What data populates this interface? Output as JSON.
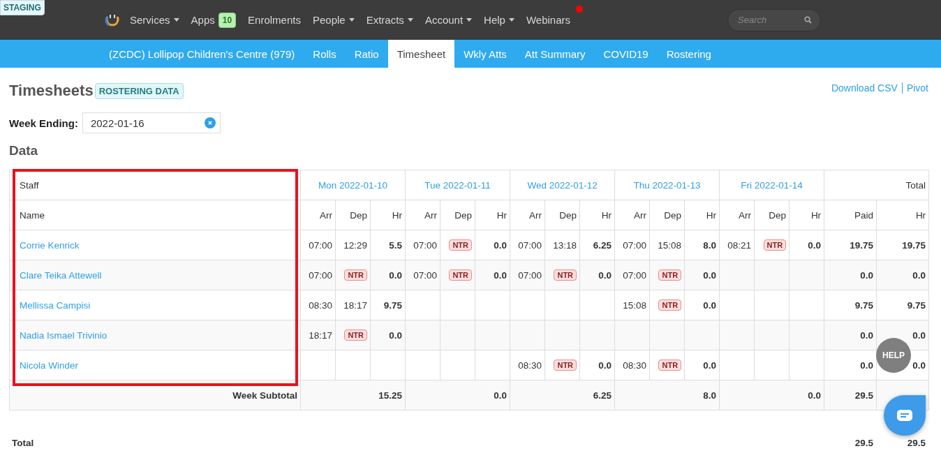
{
  "staging_badge": "STAGING",
  "nav": {
    "items": [
      {
        "label": "Services",
        "dropdown": true,
        "notification": false
      },
      {
        "label": "Apps",
        "badge": "10",
        "dropdown": false,
        "notification": false
      },
      {
        "label": "Enrolments",
        "dropdown": false,
        "notification": false
      },
      {
        "label": "People",
        "dropdown": true,
        "notification": false
      },
      {
        "label": "Extracts",
        "dropdown": true,
        "notification": false
      },
      {
        "label": "Account",
        "dropdown": true,
        "notification": false
      },
      {
        "label": "Help",
        "dropdown": true,
        "notification": false
      },
      {
        "label": "Webinars",
        "dropdown": false,
        "notification": true
      }
    ],
    "search": {
      "placeholder": "Search"
    }
  },
  "subnav": {
    "tabs": [
      {
        "label": "(ZCDC) Lollipop Children's Centre (979)",
        "selected": false
      },
      {
        "label": "Rolls",
        "selected": false
      },
      {
        "label": "Ratio",
        "selected": false
      },
      {
        "label": "Timesheet",
        "selected": true
      },
      {
        "label": "Wkly Atts",
        "selected": false
      },
      {
        "label": "Att Summary",
        "selected": false
      },
      {
        "label": "COVID19",
        "selected": false
      },
      {
        "label": "Rostering",
        "selected": false
      }
    ]
  },
  "page": {
    "title": "Timesheets",
    "tag": "ROSTERING DATA",
    "links": [
      "Download CSV",
      "Pivot"
    ],
    "week_ending": {
      "label": "Week Ending:",
      "value": "2022-01-16"
    },
    "section": "Data"
  },
  "table": {
    "group_header": "Staff",
    "name_header": "Name",
    "days": [
      {
        "label": "Mon 2022-01-10",
        "sub_headers": [
          "Arr",
          "Dep",
          "Hr"
        ],
        "subtotal": "15.25"
      },
      {
        "label": "Tue 2022-01-11",
        "sub_headers": [
          "Arr",
          "Dep",
          "Hr"
        ],
        "subtotal": "0.0"
      },
      {
        "label": "Wed 2022-01-12",
        "sub_headers": [
          "Arr",
          "Dep",
          "Hr"
        ],
        "subtotal": "6.25"
      },
      {
        "label": "Thu 2022-01-13",
        "sub_headers": [
          "Arr",
          "Dep",
          "Hr"
        ],
        "subtotal": "8.0"
      },
      {
        "label": "Fri 2022-01-14",
        "sub_headers": [
          "Arr",
          "Dep",
          "Hr"
        ],
        "subtotal": "0.0"
      }
    ],
    "total": {
      "label": "Total",
      "sub_headers": [
        "Paid",
        "Hr"
      ],
      "subtotal_paid": "29.5"
    },
    "rows": [
      {
        "name": "Corrie Kenrick",
        "days": [
          {
            "kind": "entry",
            "arr": "07:00",
            "dep": {
              "kind": "time",
              "text": "12:29"
            },
            "hr": "5.5"
          },
          {
            "kind": "entry",
            "arr": "07:00",
            "dep": {
              "kind": "badge",
              "text": "NTR"
            },
            "hr": "0.0"
          },
          {
            "kind": "entry",
            "arr": "07:00",
            "dep": {
              "kind": "time",
              "text": "13:18"
            },
            "hr": "6.25"
          },
          {
            "kind": "entry",
            "arr": "07:00",
            "dep": {
              "kind": "time",
              "text": "15:08"
            },
            "hr": "8.0"
          },
          {
            "kind": "entry",
            "arr": "08:21",
            "dep": {
              "kind": "badge",
              "text": "NTR"
            },
            "hr": "0.0"
          }
        ],
        "paid": "19.75",
        "hr": "19.75"
      },
      {
        "name": "Clare Teika Attewell",
        "days": [
          {
            "kind": "entry",
            "arr": "07:00",
            "dep": {
              "kind": "badge",
              "text": "NTR"
            },
            "hr": "0.0"
          },
          {
            "kind": "entry",
            "arr": "07:00",
            "dep": {
              "kind": "badge",
              "text": "NTR"
            },
            "hr": "0.0"
          },
          {
            "kind": "entry",
            "arr": "07:00",
            "dep": {
              "kind": "badge",
              "text": "NTR"
            },
            "hr": "0.0"
          },
          {
            "kind": "entry",
            "arr": "07:00",
            "dep": {
              "kind": "badge",
              "text": "NTR"
            },
            "hr": "0.0"
          },
          {
            "kind": "blank"
          }
        ],
        "paid": "0.0",
        "hr": "0.0"
      },
      {
        "name": "Mellissa Campisi",
        "days": [
          {
            "kind": "entry",
            "arr": "08:30",
            "dep": {
              "kind": "time",
              "text": "18:17"
            },
            "hr": "9.75"
          },
          {
            "kind": "blank"
          },
          {
            "kind": "blank"
          },
          {
            "kind": "entry",
            "arr": "15:08",
            "dep": {
              "kind": "badge",
              "text": "NTR"
            },
            "hr": "0.0"
          },
          {
            "kind": "blank"
          }
        ],
        "paid": "9.75",
        "hr": "9.75"
      },
      {
        "name": "Nadia Ismael Trivinio",
        "days": [
          {
            "kind": "entry",
            "arr": "18:17",
            "dep": {
              "kind": "badge",
              "text": "NTR"
            },
            "hr": "0.0"
          },
          {
            "kind": "blank"
          },
          {
            "kind": "blank"
          },
          {
            "kind": "blank"
          },
          {
            "kind": "blank"
          }
        ],
        "paid": "0.0",
        "hr": "0.0"
      },
      {
        "name": "Nicola Winder",
        "days": [
          {
            "kind": "blank"
          },
          {
            "kind": "blank"
          },
          {
            "kind": "entry",
            "arr": "08:30",
            "dep": {
              "kind": "badge",
              "text": "NTR"
            },
            "hr": "0.0"
          },
          {
            "kind": "entry",
            "arr": "08:30",
            "dep": {
              "kind": "badge",
              "text": "NTR"
            },
            "hr": "0.0"
          },
          {
            "kind": "blank"
          }
        ],
        "paid": "0.0",
        "hr": "0.0"
      }
    ],
    "subtotal_label": "Week Subtotal"
  },
  "grand_total": {
    "label": "Total",
    "paid": "29.5",
    "hr": "29.5"
  },
  "help_button": "HELP"
}
